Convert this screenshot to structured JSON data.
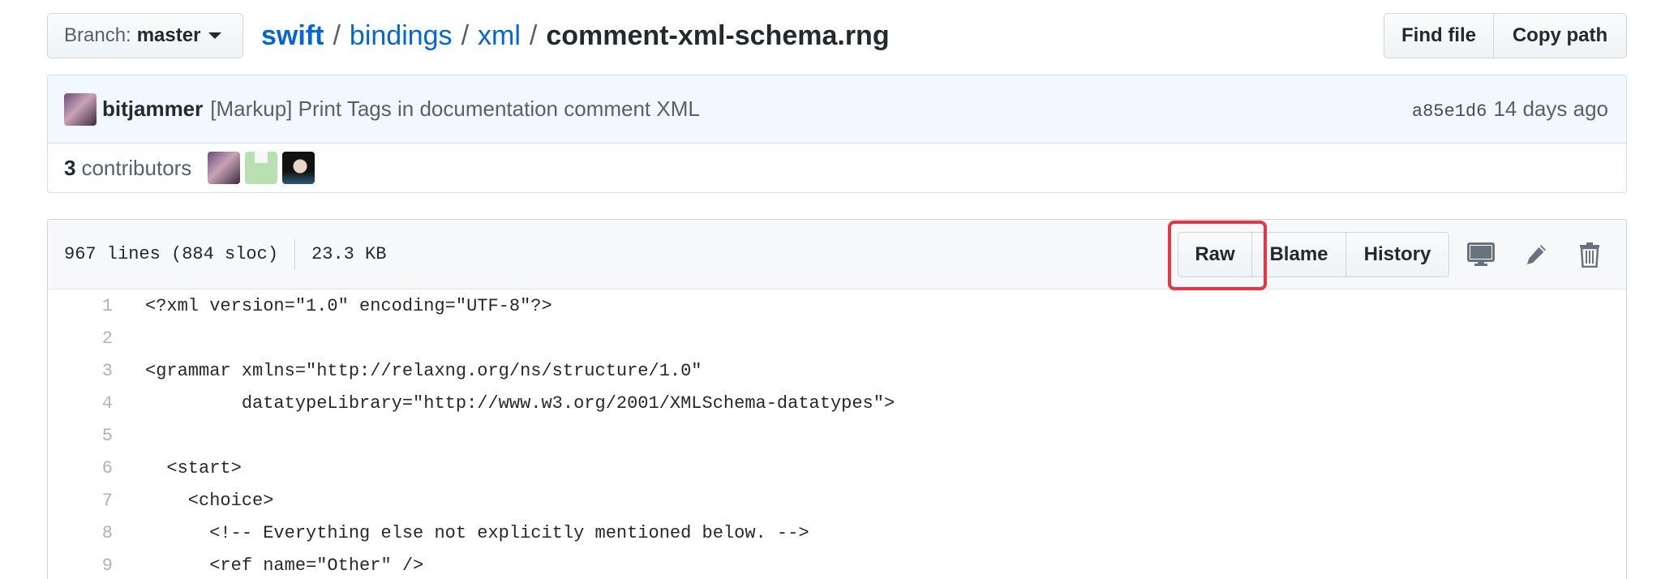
{
  "branch": {
    "prefix": "Branch:",
    "name": "master"
  },
  "breadcrumb": {
    "repo": "swift",
    "dir1": "bindings",
    "dir2": "xml",
    "file": "comment-xml-schema.rng",
    "separator": "/"
  },
  "top_buttons": {
    "find_file": "Find file",
    "copy_path": "Copy path"
  },
  "commit": {
    "author": "bitjammer",
    "message": "[Markup] Print Tags in documentation comment XML",
    "sha": "a85e1d6",
    "time_ago": "14 days ago"
  },
  "contributors": {
    "count": "3",
    "label": "contributors"
  },
  "file": {
    "lines": "967 lines (884 sloc)",
    "size": "23.3 KB",
    "actions": {
      "raw": "Raw",
      "blame": "Blame",
      "history": "History"
    }
  },
  "code_lines": [
    {
      "n": "1",
      "text": "<?xml version=\"1.0\" encoding=\"UTF-8\"?>"
    },
    {
      "n": "2",
      "text": ""
    },
    {
      "n": "3",
      "text": "<grammar xmlns=\"http://relaxng.org/ns/structure/1.0\""
    },
    {
      "n": "4",
      "text": "         datatypeLibrary=\"http://www.w3.org/2001/XMLSchema-datatypes\">"
    },
    {
      "n": "5",
      "text": ""
    },
    {
      "n": "6",
      "text": "  <start>"
    },
    {
      "n": "7",
      "text": "    <choice>"
    },
    {
      "n": "8",
      "text": "      <!-- Everything else not explicitly mentioned below. -->"
    },
    {
      "n": "9",
      "text": "      <ref name=\"Other\" />"
    }
  ],
  "icons": {
    "desktop": "desktop-icon",
    "edit": "pencil-icon",
    "delete": "trash-icon"
  },
  "colors": {
    "link": "#0366d6",
    "highlight": "#ea3343",
    "commit_bg": "#f1f8ff"
  }
}
